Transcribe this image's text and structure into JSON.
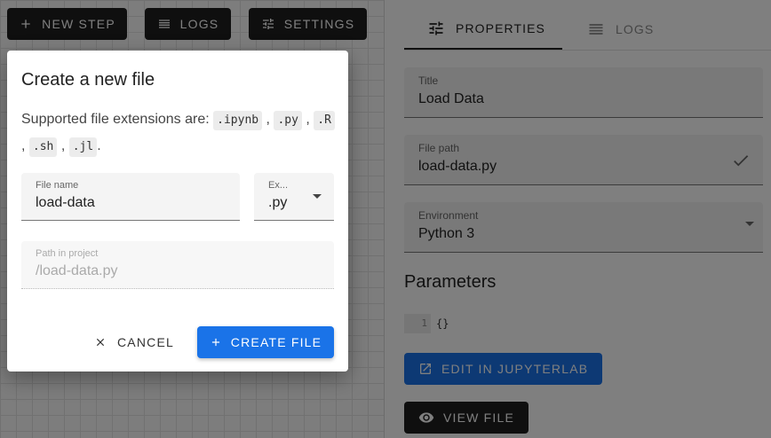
{
  "toolbar": {
    "new_step_label": "NEW STEP",
    "logs_label": "LOGS",
    "settings_label": "SETTINGS"
  },
  "panel": {
    "tabs": [
      {
        "label": "PROPERTIES",
        "icon": "tune-icon",
        "active": true
      },
      {
        "label": "LOGS",
        "icon": "list-icon",
        "active": false
      }
    ],
    "title_field": {
      "label": "Title",
      "value": "Load Data"
    },
    "file_path_field": {
      "label": "File path",
      "value": "load-data.py",
      "status_icon": "check-icon"
    },
    "environment_field": {
      "label": "Environment",
      "value": "Python 3"
    },
    "parameters_heading": "Parameters",
    "parameters_code": {
      "line_number": "1",
      "text": "{}"
    },
    "edit_button_label": "EDIT IN JUPYTERLAB",
    "view_button_label": "VIEW FILE"
  },
  "dialog": {
    "title": "Create a new file",
    "description_prefix": "Supported file extensions are:",
    "extensions": [
      ".ipynb",
      ".py",
      ".R",
      ".sh",
      ".jl"
    ],
    "file_name": {
      "label": "File name",
      "value": "load-data"
    },
    "extension": {
      "label": "Ex...",
      "value": ".py"
    },
    "path": {
      "label": "Path in project",
      "value": "/load-data.py"
    },
    "cancel_label": "CANCEL",
    "create_label": "CREATE FILE"
  },
  "colors": {
    "primary": "#1a73e8",
    "dark_button": "#1f1f1f",
    "overlay": "rgba(0,0,0,0.5)"
  }
}
